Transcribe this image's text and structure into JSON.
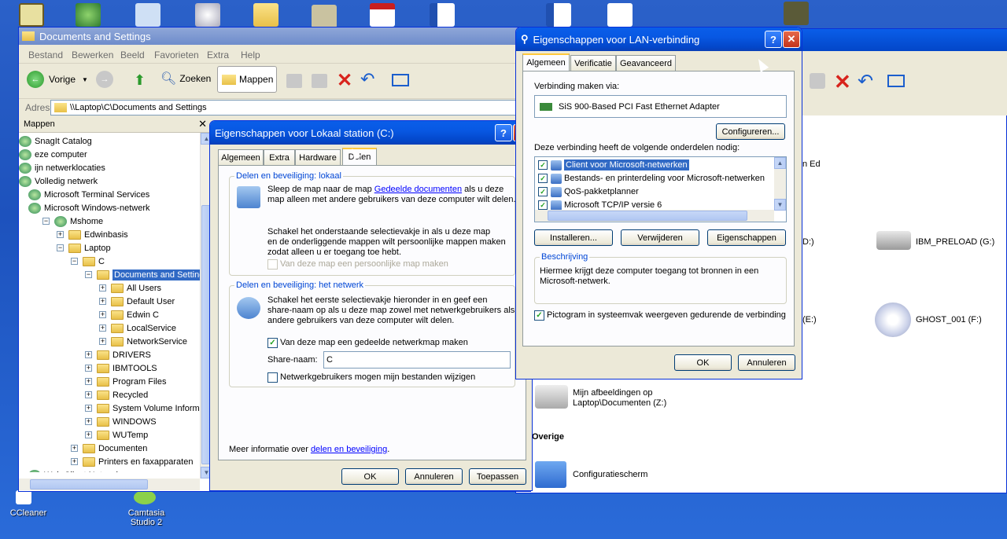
{
  "desktop": {
    "icons": [
      {
        "label": "CCleaner"
      },
      {
        "label": "Camtasia Studio 2"
      }
    ]
  },
  "explorer": {
    "title": "Documents and Settings",
    "menu": [
      "Bestand",
      "Bewerken",
      "Beeld",
      "Favorieten",
      "Extra",
      "Help"
    ],
    "toolbar": {
      "back": "Vorige",
      "search": "Zoeken",
      "folders": "Mappen"
    },
    "address_label": "Adres",
    "address": "\\\\Laptop\\C\\Documents and Settings",
    "folders_pane_title": "Mappen",
    "tree": [
      {
        "label": "SnagIt Catalog",
        "indent": 0
      },
      {
        "label": "eze computer",
        "indent": 0
      },
      {
        "label": "ijn netwerklocaties",
        "indent": 0
      },
      {
        "label": "Volledig netwerk",
        "indent": 0
      },
      {
        "label": "Microsoft Terminal Services",
        "indent": 1
      },
      {
        "label": "Microsoft Windows-netwerk",
        "indent": 1
      },
      {
        "label": "Mshome",
        "indent": 2
      },
      {
        "label": "Edwinbasis",
        "indent": 3
      },
      {
        "label": "Laptop",
        "indent": 3
      },
      {
        "label": "C",
        "indent": 4
      },
      {
        "label": "Documents and Settings",
        "indent": 5,
        "selected": true
      },
      {
        "label": "All Users",
        "indent": 6
      },
      {
        "label": "Default User",
        "indent": 6
      },
      {
        "label": "Edwin C",
        "indent": 6
      },
      {
        "label": "LocalService",
        "indent": 6
      },
      {
        "label": "NetworkService",
        "indent": 6
      },
      {
        "label": "DRIVERS",
        "indent": 5
      },
      {
        "label": "IBMTOOLS",
        "indent": 5
      },
      {
        "label": "Program Files",
        "indent": 5
      },
      {
        "label": "Recycled",
        "indent": 5
      },
      {
        "label": "System Volume Informati",
        "indent": 5
      },
      {
        "label": "WINDOWS",
        "indent": 5
      },
      {
        "label": "WUTemp",
        "indent": 5
      },
      {
        "label": "Documenten",
        "indent": 4
      },
      {
        "label": "Printers en faxapparaten",
        "indent": 4
      },
      {
        "label": "Web Client Network",
        "indent": 1
      }
    ]
  },
  "mycomputer": {
    "items": [
      {
        "label": "IBM_PRELOAD (G:)"
      },
      {
        "label": "GHOST_001 (F:)"
      },
      {
        "label": "Mijn afbeeldingen op Laptop\\Documenten (Z:)"
      },
      {
        "label": "Configuratiescherm"
      }
    ],
    "section_overige": "Overige",
    "partial_d": "D:)",
    "partial_e": "(E:)",
    "partial_ed": "n Ed"
  },
  "drive_dialog": {
    "title": "Eigenschappen voor Lokaal station (C:)",
    "tabs": [
      "Algemeen",
      "Extra",
      "Hardware",
      "Delen"
    ],
    "local_group_title": "Delen en beveiliging: lokaal",
    "local_text_1a": "Sleep de map naar de map ",
    "local_link": "Gedeelde documenten",
    "local_text_1b": " als u deze",
    "local_text_1c": "map alleen met andere gebruikers van deze computer wilt delen.",
    "local_text_2a": "Schakel het onderstaande selectievakje in als u deze map",
    "local_text_2b": "en de onderliggende mappen wilt persoonlijke mappen maken",
    "local_text_2c": "zodat alleen u er toegang toe hebt.",
    "private_checkbox": "Van deze map een persoonlijke map maken",
    "net_group_title": "Delen en beveiliging: het netwerk",
    "net_text_a": "Schakel het eerste selectievakje hieronder in en geef een",
    "net_text_b": "share-naam op als u deze map zowel met netwerkgebruikers als",
    "net_text_c": "andere gebruikers van deze computer wilt delen.",
    "share_checkbox": "Van deze map een gedeelde netwerkmap maken",
    "share_name_label": "Share-naam:",
    "share_name_value": "C",
    "modify_checkbox": "Netwerkgebruikers mogen mijn bestanden wijzigen",
    "more_info_text": "Meer informatie over ",
    "more_info_link": "delen en beveiliging",
    "more_info_end": ".",
    "ok": "OK",
    "cancel": "Annuleren",
    "apply": "Toepassen"
  },
  "lan_dialog": {
    "title": "Eigenschappen voor LAN-verbinding",
    "tabs": [
      "Algemeen",
      "Verificatie",
      "Geavanceerd"
    ],
    "connect_via_label": "Verbinding maken via:",
    "adapter": "SiS 900-Based PCI Fast Ethernet Adapter",
    "configure": "Configureren...",
    "components_label": "Deze verbinding heeft de volgende onderdelen nodig:",
    "components": [
      {
        "label": "Client voor Microsoft-netwerken",
        "checked": true,
        "selected": true
      },
      {
        "label": "Bestands- en printerdeling voor Microsoft-netwerken",
        "checked": true
      },
      {
        "label": "QoS-pakketplanner",
        "checked": true
      },
      {
        "label": "Microsoft TCP/IP versie 6",
        "checked": true
      }
    ],
    "install": "Installeren...",
    "remove": "Verwijderen",
    "properties": "Eigenschappen",
    "description_title": "Beschrijving",
    "description_a": "Hiermee krijgt deze computer toegang tot bronnen in een",
    "description_b": "Microsoft-netwerk.",
    "tray_checkbox": "Pictogram in systeemvak weergeven gedurende de verbinding",
    "ok": "OK",
    "cancel": "Annuleren"
  }
}
